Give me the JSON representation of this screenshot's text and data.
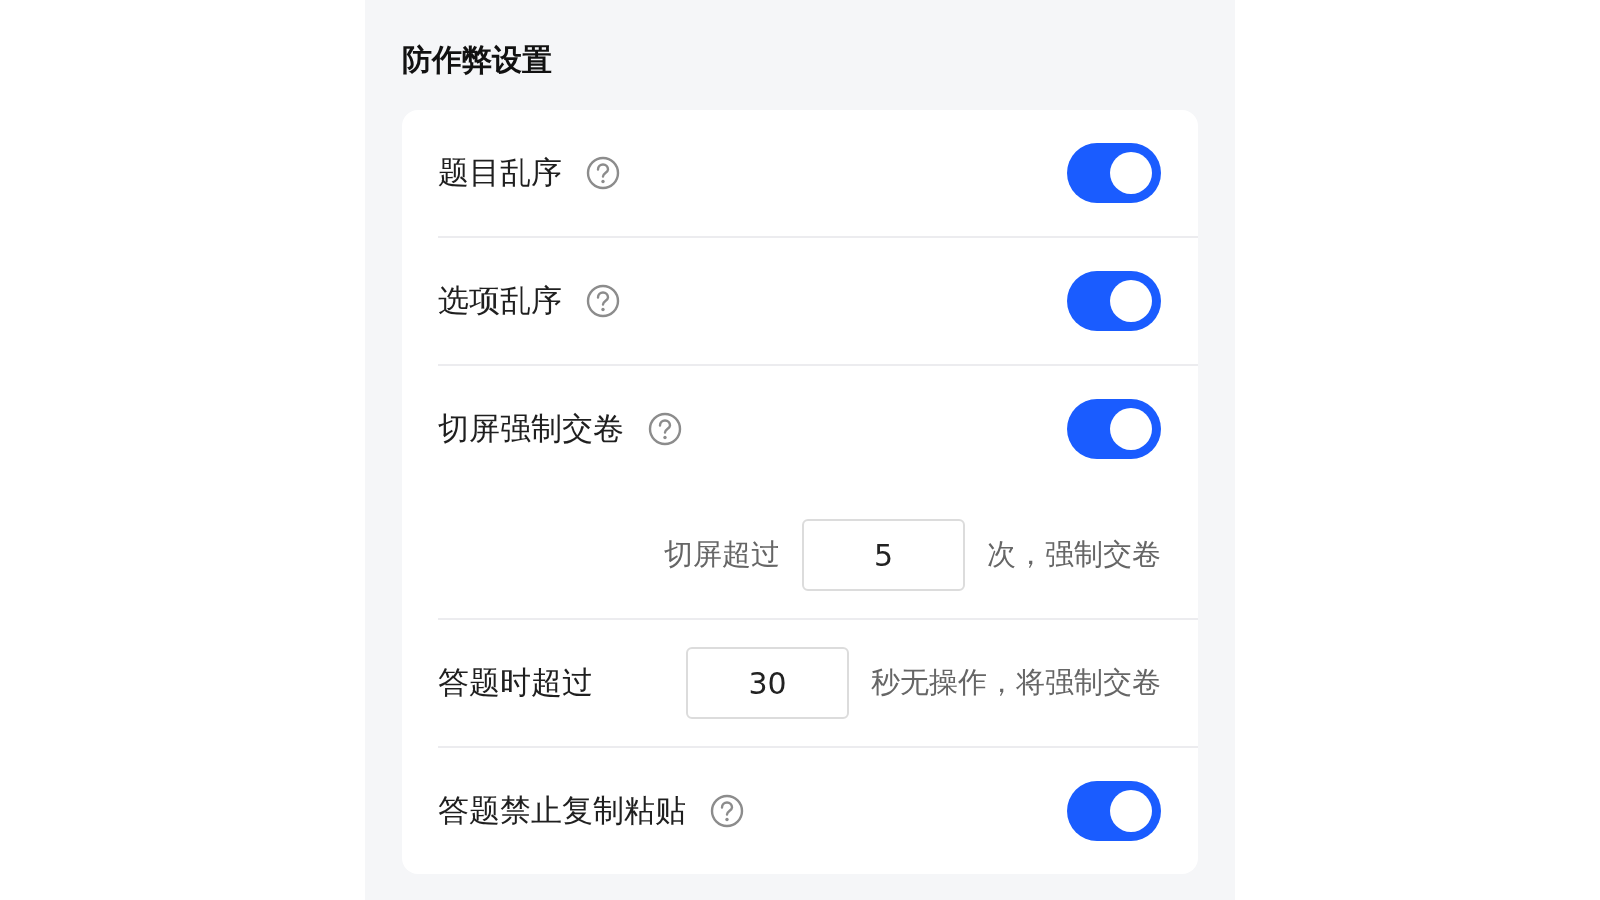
{
  "title": "防作弊设置",
  "rows": [
    {
      "kind": "toggle",
      "label": "题目乱序",
      "on": true
    },
    {
      "kind": "toggle",
      "label": "选项乱序",
      "on": true
    },
    {
      "kind": "toggle",
      "label": "切屏强制交卷",
      "on": true,
      "detail": {
        "before": "切屏超过",
        "value": "5",
        "after": "次，强制交卷"
      }
    },
    {
      "kind": "input",
      "label": "答题时超过",
      "value": "30",
      "after": "秒无操作，将强制交卷"
    },
    {
      "kind": "toggle",
      "label": "答题禁止复制粘贴",
      "on": true
    }
  ]
}
